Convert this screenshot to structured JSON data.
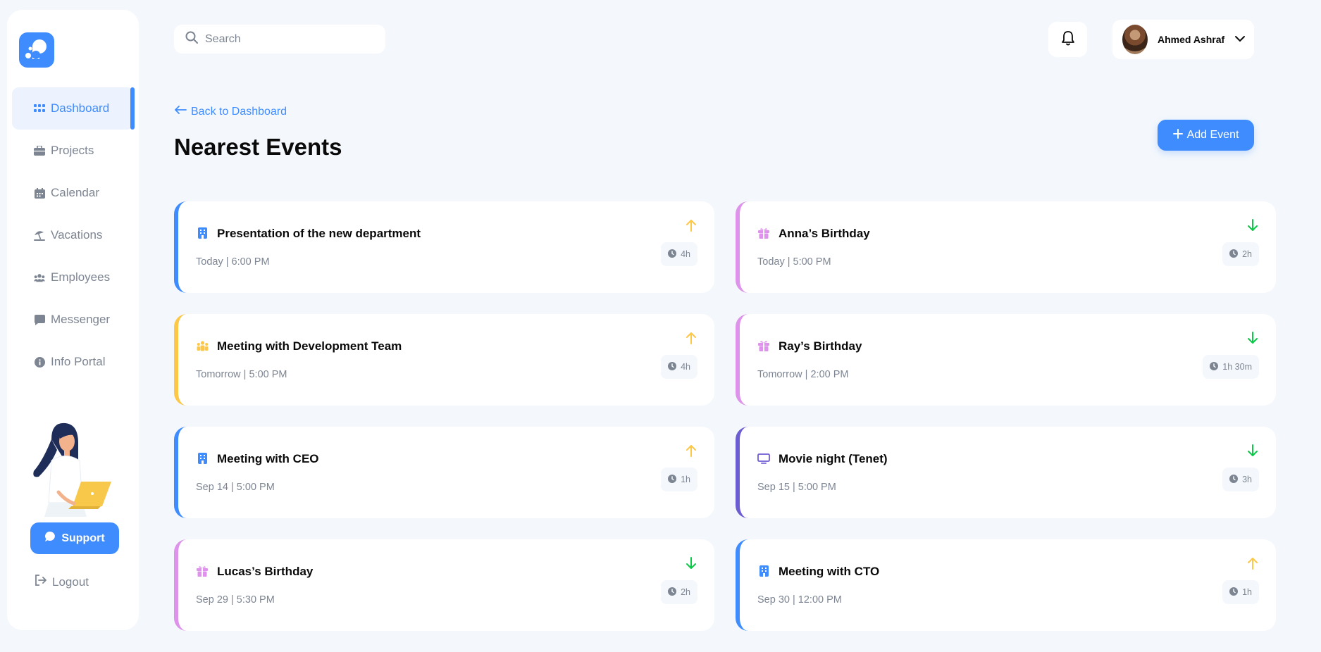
{
  "sidebar": {
    "logo": "woorkroom-logo",
    "items": [
      {
        "label": "Dashboard",
        "icon": "grid-icon",
        "active": true
      },
      {
        "label": "Projects",
        "icon": "briefcase-icon"
      },
      {
        "label": "Calendar",
        "icon": "calendar-icon"
      },
      {
        "label": "Vacations",
        "icon": "beach-umbrella-icon"
      },
      {
        "label": "Employees",
        "icon": "users-icon"
      },
      {
        "label": "Messenger",
        "icon": "chat-icon"
      },
      {
        "label": "Info Portal",
        "icon": "info-icon"
      }
    ],
    "support_label": "Support",
    "logout_label": "Logout"
  },
  "header": {
    "search_placeholder": "Search",
    "user_name": "Ahmed Ashraf"
  },
  "page": {
    "back_label": "Back to Dashboard",
    "title": "Nearest Events",
    "add_label": "Add Event"
  },
  "colors": {
    "accent": "#3f8cff",
    "yellow": "#fdc748",
    "pink": "#de92eb",
    "purple": "#6d5dd3",
    "green": "#0ac947",
    "muted": "#7d8592",
    "background": "#f4f8fc"
  },
  "events": [
    {
      "name": "Presentation of the new department",
      "when": "Today | 6:00 PM",
      "duration": "4h",
      "icon": "building-icon",
      "color": "#3f8cff",
      "priority": "up"
    },
    {
      "name": "Anna’s Birthday",
      "when": "Today | 5:00 PM",
      "duration": "2h",
      "icon": "gift-icon",
      "color": "#de92eb",
      "priority": "down"
    },
    {
      "name": "Meeting with Development Team",
      "when": "Tomorrow | 5:00 PM",
      "duration": "4h",
      "icon": "team-icon",
      "color": "#fdc748",
      "priority": "up"
    },
    {
      "name": "Ray’s Birthday",
      "when": "Tomorrow | 2:00 PM",
      "duration": "1h 30m",
      "icon": "gift-icon",
      "color": "#de92eb",
      "priority": "down"
    },
    {
      "name": "Meeting with CEO",
      "when": "Sep 14 | 5:00 PM",
      "duration": "1h",
      "icon": "building-icon",
      "color": "#3f8cff",
      "priority": "up"
    },
    {
      "name": "Movie night (Tenet)",
      "when": "Sep 15 | 5:00 PM",
      "duration": "3h",
      "icon": "monitor-icon",
      "color": "#6d5dd3",
      "priority": "down"
    },
    {
      "name": "Lucas’s Birthday",
      "when": "Sep 29 | 5:30 PM",
      "duration": "2h",
      "icon": "gift-icon",
      "color": "#de92eb",
      "priority": "down"
    },
    {
      "name": "Meeting with CTO",
      "when": "Sep 30 | 12:00 PM",
      "duration": "1h",
      "icon": "building-icon",
      "color": "#3f8cff",
      "priority": "up"
    }
  ]
}
